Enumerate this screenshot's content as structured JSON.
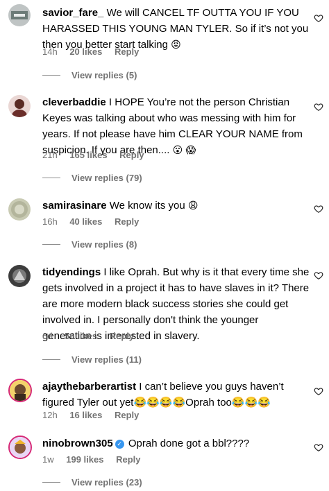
{
  "comments": [
    {
      "username": "savior_fare_",
      "text": "We will CANCEL TF OUTTA YOU IF YOU HARASSED THIS YOUNG MAN TYLER. So if it’s not you then you better start talking",
      "emoji": "😡",
      "time": "14h",
      "likes": "20 likes",
      "reply": "Reply",
      "view_replies": "View replies (5)"
    },
    {
      "username": "cleverbaddie",
      "text": "I HOPE You’re not the person Christian Keyes was talking about who was messing with him for years. If not please have him CLEAR YOUR NAME from suspicion. If you are then....",
      "emoji": "😮 😱",
      "time": "21h",
      "likes": "165 likes",
      "reply": "Reply",
      "view_replies": "View replies (79)"
    },
    {
      "username": "samirasinare",
      "text": "We know its you",
      "emoji": "😩",
      "time": "16h",
      "likes": "40 likes",
      "reply": "Reply",
      "view_replies": "View replies (8)"
    },
    {
      "username": "tidyendings",
      "text": "I like Oprah. But why is it that every time she gets involved in a project it has to have slaves in it? There are more modern black success stories she could get involved in. I personally don't think the younger generation is interested in slavery.",
      "emoji": "",
      "time": "6d",
      "likes": "56 likes",
      "reply": "Reply",
      "view_replies": "View replies (11)"
    },
    {
      "username": "ajaythebarberartist",
      "text": "I can’t believe you guys haven’t figured Tyler out yet😂😂😂😂Oprah too😂😂😂",
      "emoji": "",
      "time": "12h",
      "likes": "16 likes",
      "reply": "Reply",
      "view_replies": ""
    },
    {
      "username": "ninobrown305",
      "text": "Oprah done got a bbl????",
      "emoji": "",
      "time": "1w",
      "likes": "199 likes",
      "reply": "Reply",
      "view_replies": "View replies (23)"
    }
  ],
  "icons": {
    "heart": "heart-outline-icon",
    "verified": "verified-badge-icon"
  },
  "colors": {
    "meta": "#737373",
    "verified": "#3897f0"
  }
}
